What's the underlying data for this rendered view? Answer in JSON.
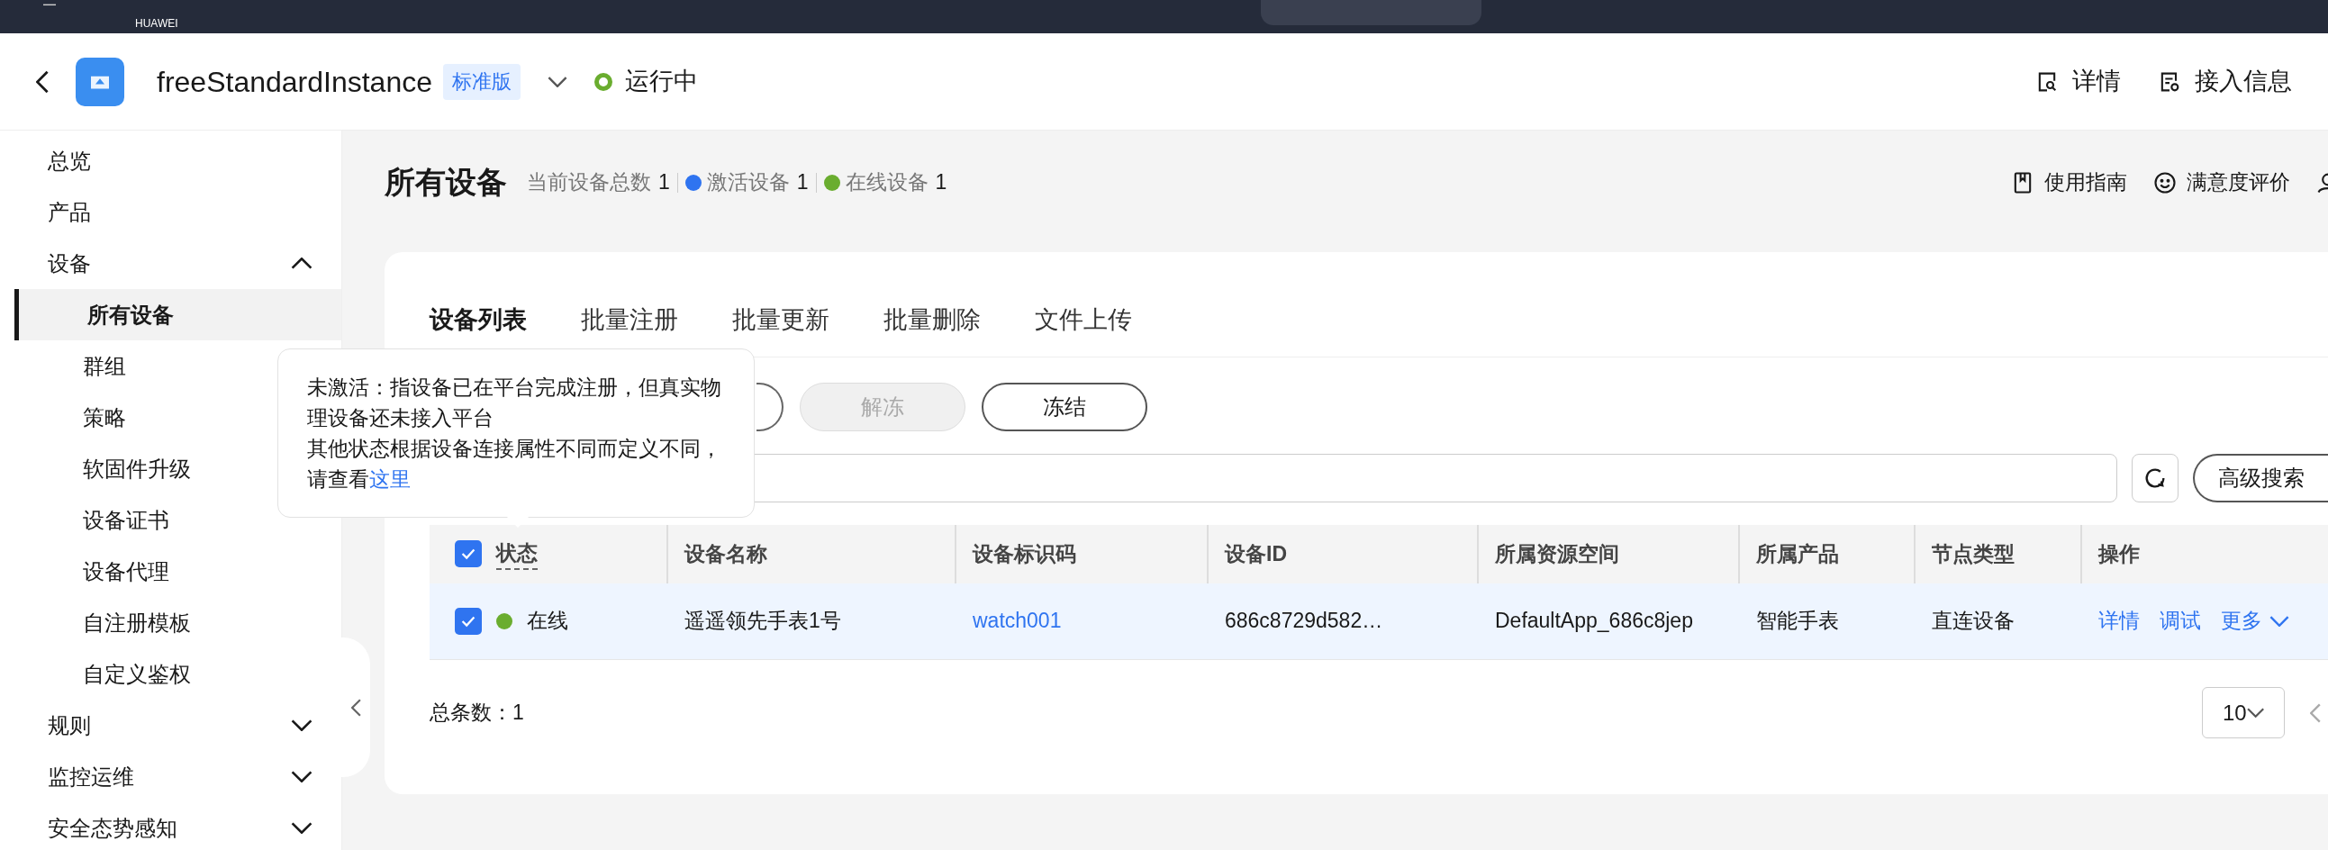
{
  "top_bar": {
    "brand": "HUAWEI"
  },
  "header": {
    "title": "freeStandardInstance",
    "edition": "标准版",
    "status": "运行中",
    "actions": [
      {
        "label": "详情",
        "kind": "detail"
      },
      {
        "label": "接入信息",
        "kind": "access"
      }
    ]
  },
  "sidebar": {
    "items": [
      {
        "label": "总览",
        "selected": false
      },
      {
        "label": "产品",
        "selected": false
      },
      {
        "label": "设备",
        "selected": false,
        "expanded": true,
        "children": [
          {
            "label": "所有设备",
            "selected": true
          },
          {
            "label": "群组",
            "selected": false
          },
          {
            "label": "策略",
            "selected": false
          },
          {
            "label": "软固件升级",
            "selected": false
          },
          {
            "label": "设备证书",
            "selected": false
          },
          {
            "label": "设备代理",
            "selected": false
          },
          {
            "label": "自注册模板",
            "selected": false
          },
          {
            "label": "自定义鉴权",
            "selected": false
          }
        ]
      },
      {
        "label": "规则",
        "selected": false,
        "expanded": false
      },
      {
        "label": "监控运维",
        "selected": false,
        "expanded": false
      },
      {
        "label": "安全态势感知",
        "selected": false,
        "expanded": false
      }
    ]
  },
  "page": {
    "title": "所有设备",
    "stats": [
      {
        "label": "当前设备总数",
        "value": "1"
      },
      {
        "label": "激活设备",
        "value": "1",
        "color": "#2f74f0"
      },
      {
        "label": "在线设备",
        "value": "1",
        "color": "#6aad2f"
      }
    ],
    "links": [
      {
        "label": "使用指南",
        "kind": "guide"
      },
      {
        "label": "满意度评价",
        "kind": "rating"
      }
    ]
  },
  "tabs": [
    {
      "label": "设备列表",
      "selected": true
    },
    {
      "label": "批量注册",
      "selected": false
    },
    {
      "label": "批量更新",
      "selected": false
    },
    {
      "label": "批量删除",
      "selected": false
    },
    {
      "label": "文件上传",
      "selected": false
    }
  ],
  "buttons": [
    {
      "label": "解冻",
      "disabled": true
    },
    {
      "label": "冻结",
      "disabled": false
    }
  ],
  "search": {
    "advanced": "高级搜索"
  },
  "table": {
    "all_checked": true,
    "columns": [
      "状态",
      "设备名称",
      "设备标识码",
      "设备ID",
      "所属资源空间",
      "所属产品",
      "节点类型",
      "操作"
    ],
    "rows": [
      {
        "checked": true,
        "status": "在线",
        "color": "#6aad2f",
        "name": "遥遥领先手表1号",
        "code": "watch001",
        "id": "686c8729d582…",
        "space": "DefaultApp_686c8jep",
        "product": "智能手表",
        "node_type": "直连设备",
        "actions": [
          "详情",
          "调试",
          "更多"
        ]
      }
    ]
  },
  "footer": {
    "total": "总条数：1",
    "page_size": "10"
  },
  "tooltip": {
    "text": "未激活：指设备已在平台完成注册，但真实物理设备还未接入平台",
    "text2": "其他状态根据设备连接属性不同而定义不同，请查看",
    "link": "这里"
  }
}
